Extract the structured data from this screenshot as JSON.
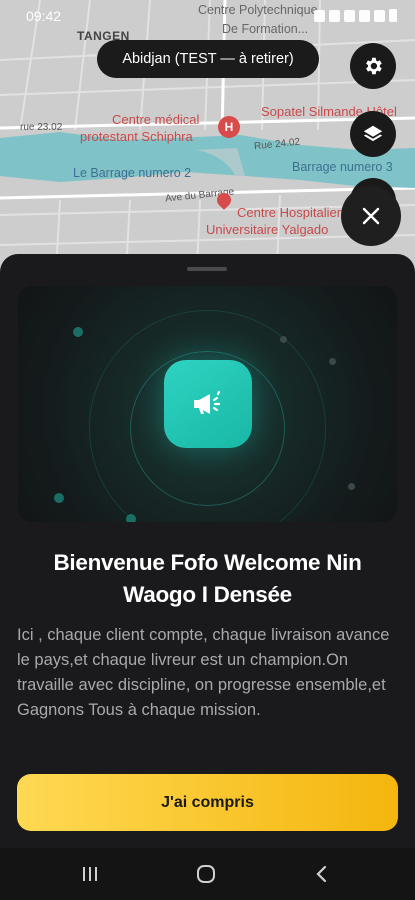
{
  "status_bar": {
    "time": "09:42"
  },
  "map": {
    "city_pill": "Abidjan (TEST — à retirer)",
    "labels": {
      "centre_polytech": "Centre Polytechnique",
      "de_formation": "De Formation...",
      "tangen": "TANGEN",
      "centre_medical": "Centre médical",
      "protestant": "protestant Schiphra",
      "sopatel": "Sopatel Silmande Hôtel",
      "rue_2302": "rue 23.02",
      "rue_2402": "Rue 24.02",
      "barrage2": "Le Barrage numero 2",
      "barrage3": "Barrage numero 3",
      "ave_barrage": "Ave du Barrage",
      "chu": "Centre Hospitalier",
      "chu2": "Universitaire Yalgado"
    }
  },
  "modal": {
    "title": "Bienvenue  Fofo  Welcome Nin Waogo I Densée",
    "body": "Ici , chaque client compte, chaque livraison avance le pays,et chaque livreur est un champion.On travaille avec discipline, on progresse ensemble,et Gagnons Tous à chaque mission.",
    "cta_label": "J'ai compris"
  },
  "icons": {
    "settings": "gear-icon",
    "layers": "layers-icon",
    "close": "close-icon",
    "hero": "megaphone-icon",
    "nav_recent": "recent-apps-icon",
    "nav_home": "home-icon",
    "nav_back": "back-icon"
  },
  "colors": {
    "accent_teal": "#22c4b2",
    "cta_yellow": "#f7c530",
    "sheet_bg": "#1a1a1c",
    "map_red": "#c94a4a"
  }
}
